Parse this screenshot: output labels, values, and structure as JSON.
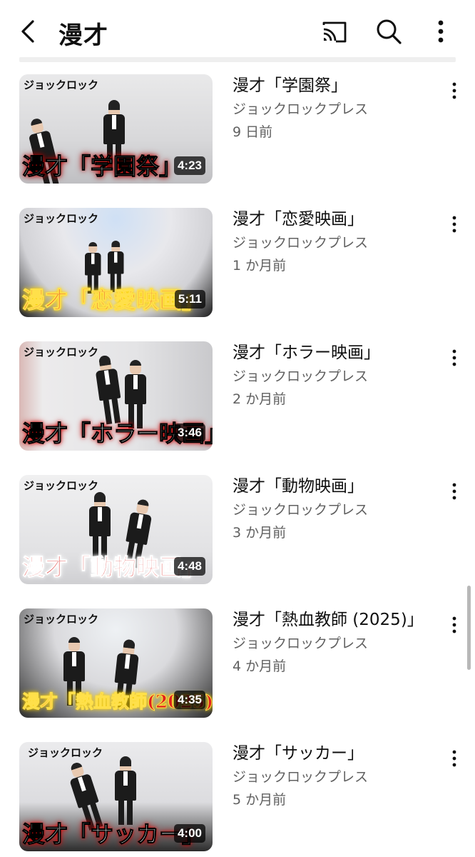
{
  "header": {
    "title": "漫才",
    "icons": {
      "back": "chevron-left-icon",
      "cast": "cast-icon",
      "search": "search-icon",
      "more": "more-vert-icon"
    }
  },
  "videos": [
    {
      "title": "漫才「学園祭」",
      "channel": "ジョックロックプレス",
      "age": "9 日前",
      "duration": "4:23",
      "brand": "ジョックロック",
      "caption": "漫才「学園祭」"
    },
    {
      "title": "漫才「恋愛映画」",
      "channel": "ジョックロックプレス",
      "age": "1 か月前",
      "duration": "5:11",
      "brand": "ジョックロック",
      "caption": "漫才「恋愛映画」"
    },
    {
      "title": "漫才「ホラー映画」",
      "channel": "ジョックロックプレス",
      "age": "2 か月前",
      "duration": "3:46",
      "brand": "ジョックロック",
      "caption": "漫才「ホラー映画」"
    },
    {
      "title": "漫才「動物映画」",
      "channel": "ジョックロックプレス",
      "age": "3 か月前",
      "duration": "4:48",
      "brand": "ジョックロック",
      "caption": "漫才「動物映画」"
    },
    {
      "title": "漫才「熱血教師 (2025)」",
      "channel": "ジョックロックプレス",
      "age": "4 か月前",
      "duration": "4:35",
      "brand": "ジョックロック",
      "caption": "漫才「熱血教師(2025)」"
    },
    {
      "title": "漫才「サッカー」",
      "channel": "ジョックロックプレス",
      "age": "5 か月前",
      "duration": "4:00",
      "brand": "ジョックロック",
      "caption": "漫才「サッカー」"
    }
  ],
  "colors": {
    "text_primary": "#0f0f0f",
    "text_secondary": "#606060",
    "divider": "#efefef"
  }
}
